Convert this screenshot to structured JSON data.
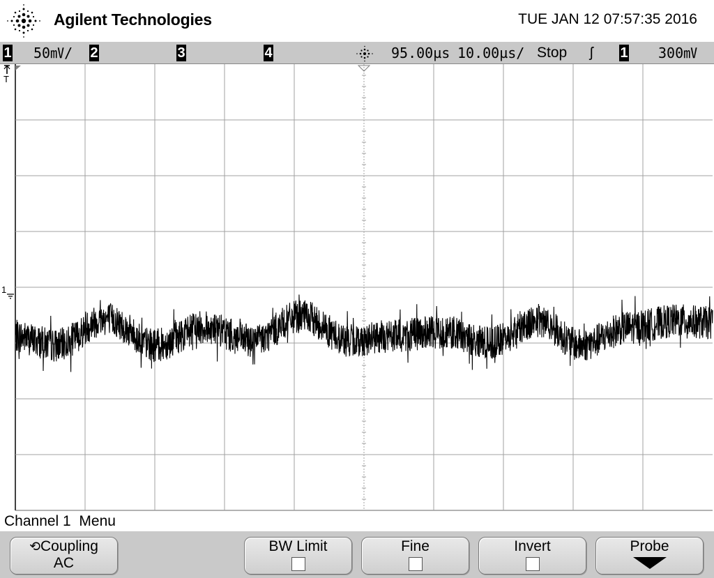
{
  "header": {
    "brand": "Agilent Technologies",
    "datetime": "TUE JAN 12 07:57:35 2016"
  },
  "status": {
    "ch1_label": "1",
    "ch1_scale": "50㎷/",
    "ch2_label": "2",
    "ch3_label": "3",
    "ch4_label": "4",
    "delay": "95.00µs",
    "timebase": "10.00µs/",
    "run_state": "Stop",
    "trigger_slope": "ʃ",
    "trigger_channel": "1",
    "trigger_level": "300㎷"
  },
  "markers": {
    "trigger_marker": "T",
    "ch1_ground_marker": "1"
  },
  "menu": {
    "title": "Channel 1  Menu",
    "coupling_label": "Coupling",
    "coupling_value": "AC",
    "bw_limit_label": "BW Limit",
    "fine_label": "Fine",
    "invert_label": "Invert",
    "probe_label": "Probe"
  },
  "colors": {
    "trace": "#000000",
    "grid": "#a0a0a0",
    "statusbar": "#c8c8c8"
  },
  "chart_data": {
    "type": "line",
    "title": "",
    "xlabel": "",
    "ylabel": "",
    "x_divisions": 10,
    "y_divisions": 8,
    "time_per_div_us": 10,
    "volts_per_div_mV": 50,
    "delay_us": 95,
    "xlim_us": [
      45,
      145
    ],
    "ylim_mV": [
      -160,
      240
    ],
    "grid": true,
    "series": [
      {
        "noise_pp_mV": 30,
        "x_us": [
          45,
          51,
          58,
          65,
          72,
          79,
          86,
          93,
          99,
          106,
          113,
          120,
          126,
          133,
          140,
          145
        ],
        "y_mV": [
          -4,
          -12,
          12,
          -12,
          4,
          -8,
          14,
          -8,
          -4,
          0,
          -10,
          10,
          -12,
          4,
          10,
          8
        ]
      }
    ]
  }
}
